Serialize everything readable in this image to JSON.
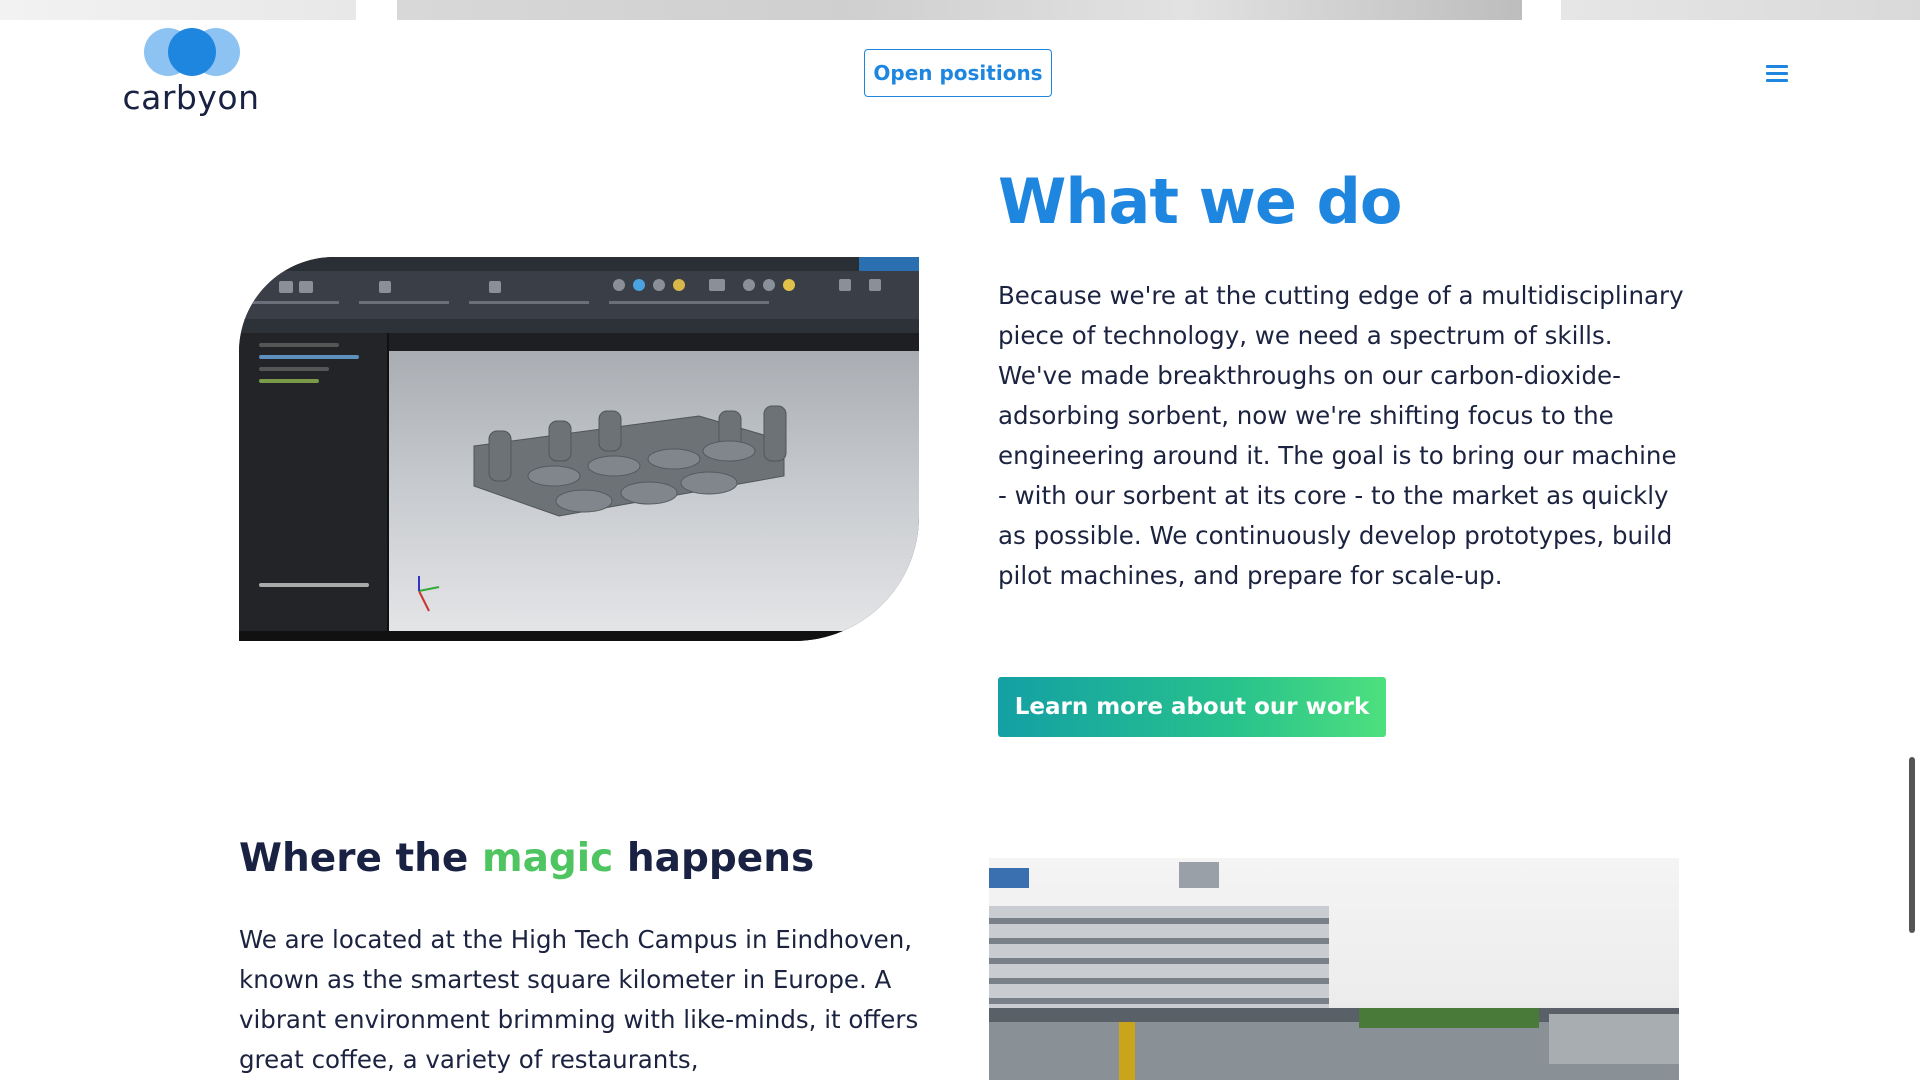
{
  "header": {
    "logo_text": "carbyon",
    "open_positions_label": "Open positions",
    "menu_icon": "hamburger-menu-icon"
  },
  "what_we_do": {
    "title": "What we do",
    "body": "Because we're at the cutting edge of a multidisciplinary piece of technology, we need a spectrum of skills. We've made breakthroughs on our carbon-dioxide-adsorbing sorbent, now we're shifting focus to the engineering around it. The goal is to bring our machine - with our sorbent at its core - to the market as quickly as possible. We continuously develop prototypes, build pilot machines, and prepare for scale-up.",
    "cta_label": "Learn more about our work",
    "image": "cad-software-screenshot"
  },
  "magic": {
    "title_prefix": "Where the ",
    "title_highlight": "magic",
    "title_suffix": " happens",
    "body": "We are located at the High Tech Campus in Eindhoven, known as the smartest square kilometer in Europe. A vibrant environment brimming with like-minds, it offers great coffee, a variety of restaurants,",
    "image": "high-tech-campus-building-photo"
  },
  "colors": {
    "brand_blue": "#1f86e0",
    "navy": "#1a2244",
    "green_highlight": "#4fc561",
    "cta_gradient_start": "#14a0a4",
    "cta_gradient_end": "#4ee07e"
  }
}
